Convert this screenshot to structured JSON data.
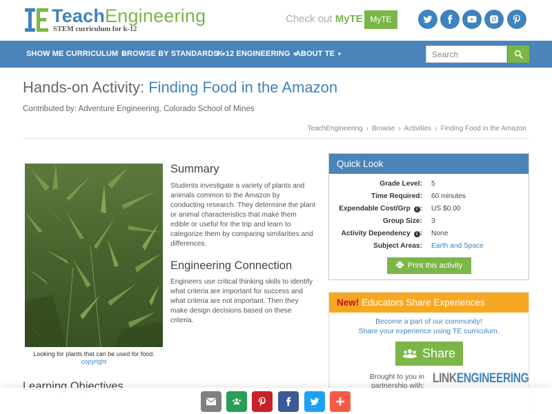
{
  "logo": {
    "name_part1": "Teach",
    "name_part2": "Engineering",
    "tagline": "STEM curriculum for k-12"
  },
  "promo": {
    "prefix": "Check out ",
    "brand": "MyTE",
    "button_label": "MyTE"
  },
  "social_icons": [
    "twitter-icon",
    "facebook-icon",
    "youtube-icon",
    "instagram-icon",
    "pinterest-icon"
  ],
  "nav": {
    "items": [
      {
        "label": "SHOW ME CURRICULUM"
      },
      {
        "label": "BROWSE BY STANDARDS"
      },
      {
        "label": "K-12 ENGINEERING"
      },
      {
        "label": "ABOUT TE"
      }
    ],
    "search_placeholder": "Search"
  },
  "page": {
    "type_label": "Hands-on Activity: ",
    "title": "Finding Food in the Amazon",
    "contributed": "Contributed by: Adventure Engineering, Colorado School of Mines"
  },
  "breadcrumb": [
    "TeachEngineering",
    "Browse",
    "Activities",
    "Finding Food in the Amazon"
  ],
  "image": {
    "caption": "Looking for plants that can be used for food.",
    "credit": "copyright"
  },
  "summary": {
    "heading": "Summary",
    "text": "Students investigate a variety of plants and animals common to the Amazon by conducting research. They determine the plant or animal characteristics that make them edible or useful for the trip and learn to categorize them by comparing similarities and differences."
  },
  "engineering": {
    "heading": "Engineering Connection",
    "text": "Engineers use critical thinking skills to identify what criteria are important for success and what criteria are not important. Then they make design decisions based on these criteria."
  },
  "quick_look": {
    "heading": "Quick Look",
    "rows": [
      {
        "label": "Grade Level:",
        "value": "5"
      },
      {
        "label": "Time Required:",
        "value": "60 minutes"
      },
      {
        "label": "Expendable Cost/Grp",
        "value": "US $0.00"
      },
      {
        "label": "Group Size:",
        "value": "3"
      },
      {
        "label": "Activity Dependency",
        "value": "None"
      },
      {
        "label": "Subject Areas:",
        "value": "Earth and Space"
      }
    ],
    "print_label": "Print this activity"
  },
  "share": {
    "new_label": "New!",
    "heading": " Educators Share Experiences",
    "line1": "Become a part of our community!",
    "line2": "Share your experience using TE curriculum.",
    "button_label": "Share",
    "brought_by": "Brought to you in partnership with:",
    "partner_part1": "LINK",
    "partner_part2": "ENGINEERING"
  },
  "learning_objectives": {
    "heading": "Learning Objectives"
  },
  "share_bar": {
    "buttons": [
      {
        "icon": "email-icon",
        "color": "#808080"
      },
      {
        "icon": "google-classroom-icon",
        "color": "#2a9d56"
      },
      {
        "icon": "pinterest-icon",
        "color": "#cb2027"
      },
      {
        "icon": "facebook-icon",
        "color": "#3b5998"
      },
      {
        "icon": "twitter-icon",
        "color": "#1da1f2"
      },
      {
        "icon": "more-icon",
        "color": "#f65a46"
      }
    ]
  },
  "colors": {
    "brand_blue": "#3f83bd",
    "nav_blue": "#4a84b8",
    "brand_green": "#7ab648",
    "share_orange": "#f7a823"
  }
}
